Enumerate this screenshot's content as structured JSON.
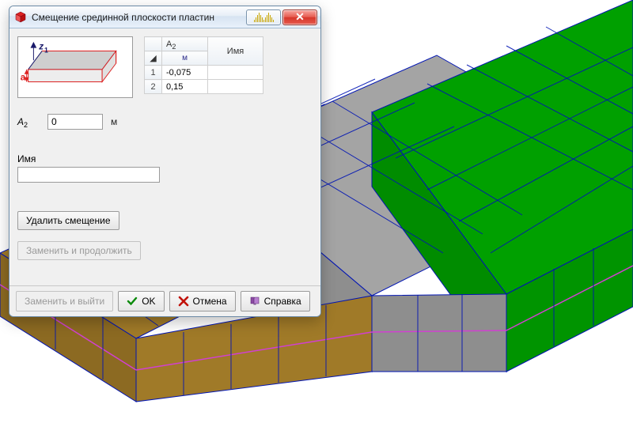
{
  "window": {
    "title": "Смещение срединной плоскости пластин"
  },
  "diagram": {
    "z_label": "z",
    "z_sub": "1",
    "a_label": "a"
  },
  "grid": {
    "col_a_label": "A",
    "col_a_sub": "2",
    "col_unit": "м",
    "col_name": "Имя",
    "rows": [
      {
        "n": "1",
        "val": "-0,075",
        "name": ""
      },
      {
        "n": "2",
        "val": "0,15",
        "name": ""
      }
    ]
  },
  "fields": {
    "a2_label_main": "A",
    "a2_label_sub": "2",
    "a2_value": "0",
    "a2_unit": "м",
    "name_label": "Имя",
    "name_value": ""
  },
  "buttons": {
    "delete": "Удалить смещение",
    "replace_continue": "Заменить и продолжить",
    "replace_exit": "Заменить и выйти",
    "ok": "OK",
    "cancel": "Отмена",
    "help": "Справка"
  }
}
